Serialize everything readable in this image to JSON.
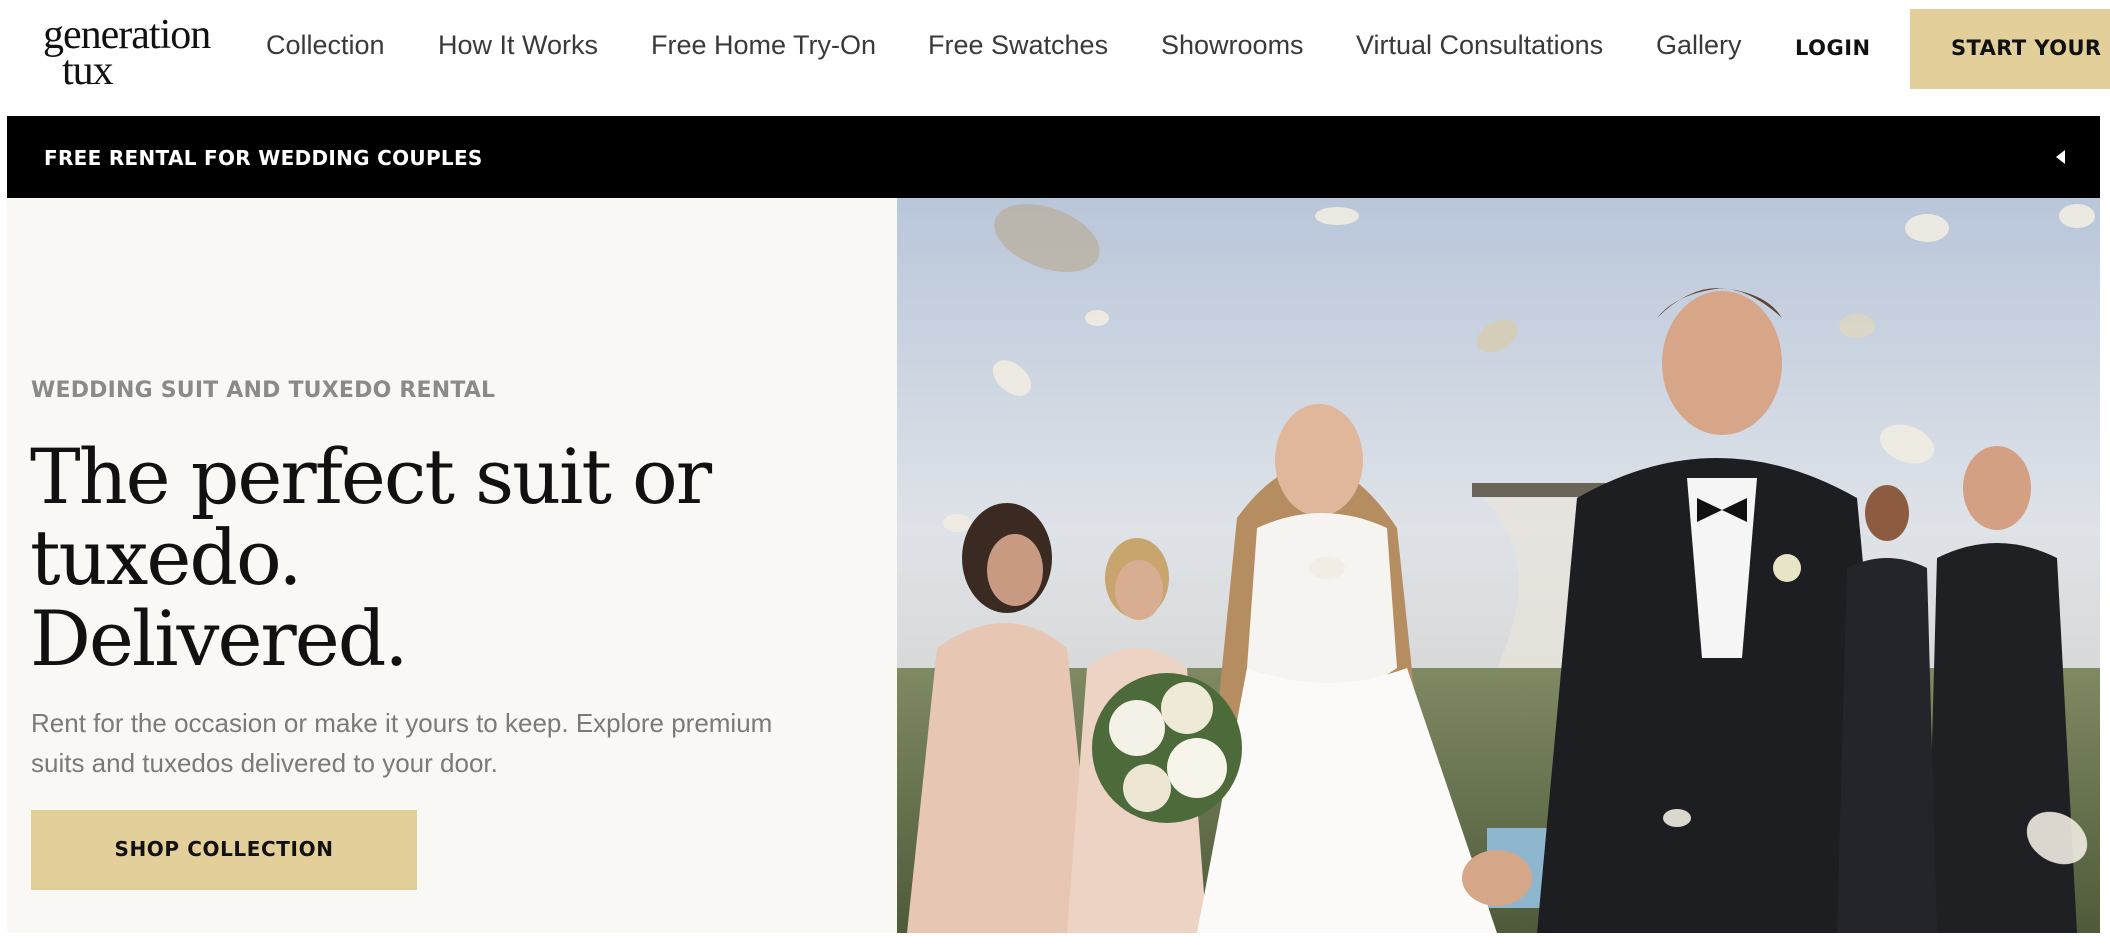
{
  "header": {
    "logo_line1": "generation",
    "logo_line2": "tux",
    "nav": [
      {
        "label": "Collection"
      },
      {
        "label": "How It Works"
      },
      {
        "label": "Free Home Try-On"
      },
      {
        "label": "Free Swatches"
      },
      {
        "label": "Showrooms"
      },
      {
        "label": "Virtual Consultations"
      },
      {
        "label": "Gallery"
      }
    ],
    "login_label": "LOGIN",
    "cta_label": "START YOUR EVENT"
  },
  "promo": {
    "text": "FREE RENTAL FOR WEDDING COUPLES",
    "arrow_icon": "chevron-left-icon"
  },
  "hero": {
    "eyebrow": "WEDDING SUIT AND TUXEDO RENTAL",
    "headline_lines": [
      "The perfect suit or",
      "tuxedo.",
      "Delivered."
    ],
    "subcopy_lines": [
      "Rent for the occasion or make it yours to keep. Explore premium",
      "suits and tuxedos delivered to your door."
    ],
    "button_label": "SHOP COLLECTION"
  },
  "colors": {
    "accent": "#e3cf9a",
    "promo_bg": "#000000",
    "hero_left_bg": "#f9f8f4"
  }
}
